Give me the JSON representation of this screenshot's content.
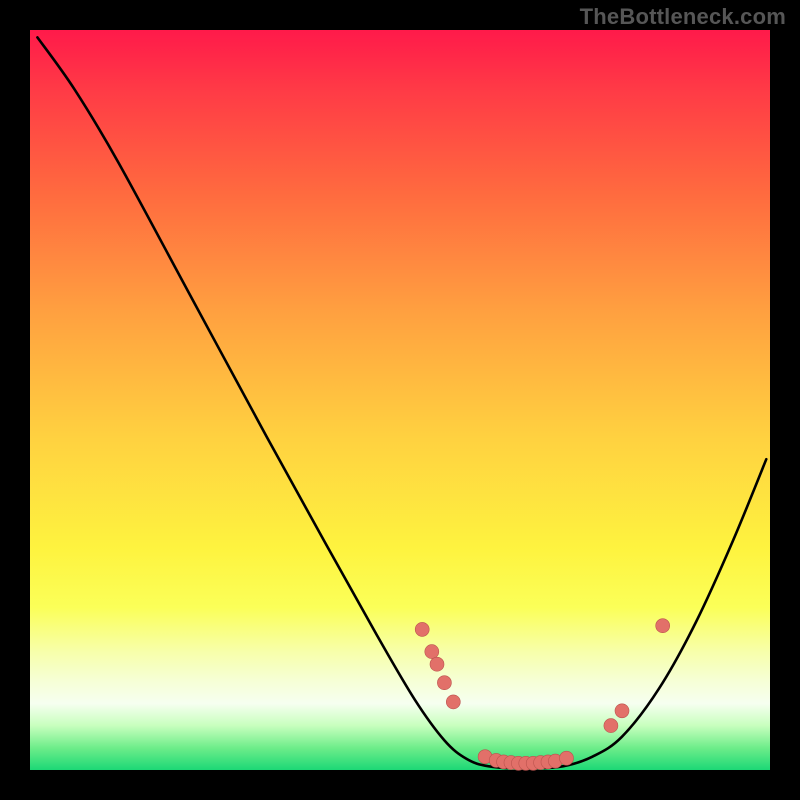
{
  "attribution": "TheBottleneck.com",
  "colors": {
    "frame": "#000000",
    "attribution_text": "#565656",
    "curve": "#000000",
    "dot_fill": "#e27069",
    "dot_stroke": "#bb534e",
    "gradient_stops": [
      {
        "pct": 0,
        "hex": "#ff1a4a"
      },
      {
        "pct": 8,
        "hex": "#ff3a46"
      },
      {
        "pct": 22,
        "hex": "#ff6a3f"
      },
      {
        "pct": 38,
        "hex": "#ffa040"
      },
      {
        "pct": 55,
        "hex": "#ffd140"
      },
      {
        "pct": 70,
        "hex": "#fef33f"
      },
      {
        "pct": 78,
        "hex": "#fbff58"
      },
      {
        "pct": 84,
        "hex": "#f7ffaa"
      },
      {
        "pct": 88,
        "hex": "#f6ffd6"
      },
      {
        "pct": 91,
        "hex": "#f6fff0"
      },
      {
        "pct": 94,
        "hex": "#c8ffbe"
      },
      {
        "pct": 97,
        "hex": "#6eed8a"
      },
      {
        "pct": 100,
        "hex": "#1cd876"
      }
    ]
  },
  "chart_data": {
    "type": "line",
    "title": "",
    "xlabel": "",
    "ylabel": "",
    "xlim": [
      0,
      100
    ],
    "ylim": [
      0,
      100
    ],
    "grid": false,
    "curve": [
      {
        "x": 1.0,
        "y": 99.0
      },
      {
        "x": 6.0,
        "y": 92.0
      },
      {
        "x": 12.0,
        "y": 82.0
      },
      {
        "x": 22.0,
        "y": 63.5
      },
      {
        "x": 32.0,
        "y": 45.0
      },
      {
        "x": 40.0,
        "y": 30.5
      },
      {
        "x": 47.0,
        "y": 18.0
      },
      {
        "x": 52.0,
        "y": 9.5
      },
      {
        "x": 56.0,
        "y": 4.0
      },
      {
        "x": 59.0,
        "y": 1.5
      },
      {
        "x": 62.0,
        "y": 0.5
      },
      {
        "x": 67.0,
        "y": 0.2
      },
      {
        "x": 72.0,
        "y": 0.5
      },
      {
        "x": 76.0,
        "y": 1.8
      },
      {
        "x": 80.0,
        "y": 4.5
      },
      {
        "x": 85.0,
        "y": 11.0
      },
      {
        "x": 90.0,
        "y": 20.0
      },
      {
        "x": 95.0,
        "y": 31.0
      },
      {
        "x": 99.5,
        "y": 42.0
      }
    ],
    "points": [
      {
        "x": 53.0,
        "y": 19.0
      },
      {
        "x": 54.3,
        "y": 16.0
      },
      {
        "x": 55.0,
        "y": 14.3
      },
      {
        "x": 56.0,
        "y": 11.8
      },
      {
        "x": 57.2,
        "y": 9.2
      },
      {
        "x": 61.5,
        "y": 1.8
      },
      {
        "x": 63.0,
        "y": 1.3
      },
      {
        "x": 64.0,
        "y": 1.1
      },
      {
        "x": 65.0,
        "y": 1.0
      },
      {
        "x": 66.0,
        "y": 0.9
      },
      {
        "x": 67.0,
        "y": 0.9
      },
      {
        "x": 68.0,
        "y": 0.9
      },
      {
        "x": 69.0,
        "y": 1.0
      },
      {
        "x": 70.0,
        "y": 1.1
      },
      {
        "x": 71.0,
        "y": 1.2
      },
      {
        "x": 72.5,
        "y": 1.6
      },
      {
        "x": 78.5,
        "y": 6.0
      },
      {
        "x": 80.0,
        "y": 8.0
      },
      {
        "x": 85.5,
        "y": 19.5
      }
    ]
  }
}
